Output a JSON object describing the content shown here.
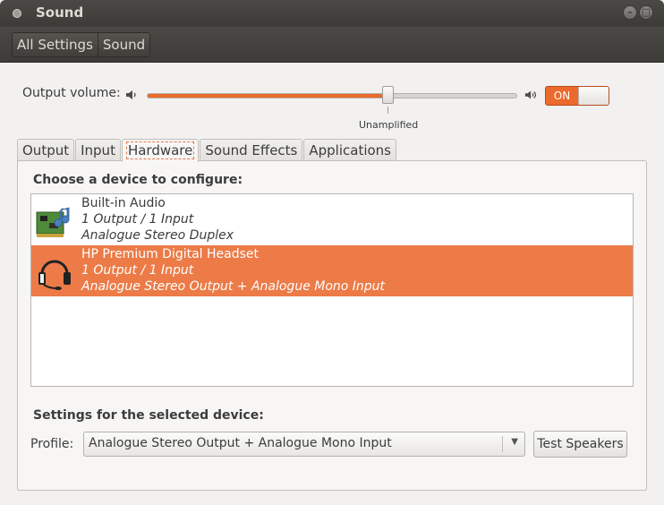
{
  "window": {
    "title": "Sound",
    "controls": [
      "minimize-icon",
      "maximize-icon",
      "close-icon"
    ]
  },
  "toolbar": {
    "breadcrumbs": [
      "All Settings",
      "Sound"
    ]
  },
  "output_volume": {
    "label": "Output volume:",
    "level": 0.65,
    "mark_label": "Unamplified",
    "switch_label": "ON",
    "accent": "#ec6a2b"
  },
  "tabs": [
    "Output",
    "Input",
    "Hardware",
    "Sound Effects",
    "Applications"
  ],
  "active_tab": "Hardware",
  "hardware": {
    "choose_title": "Choose a device to configure:",
    "devices": [
      {
        "name": "Built-in Audio",
        "line1": "1 Output / 1 Input",
        "line2": "Analogue Stereo Duplex",
        "icon": "sound-card-icon",
        "selected": false
      },
      {
        "name": "HP Premium Digital Headset",
        "line1": "1 Output / 1 Input",
        "line2": "Analogue Stereo Output + Analogue Mono Input",
        "icon": "headset-icon",
        "selected": true
      }
    ],
    "settings_title": "Settings for the selected device:",
    "profile_label": "Profile:",
    "profile_value": "Analogue Stereo Output + Analogue Mono Input",
    "test_button": "Test Speakers"
  }
}
